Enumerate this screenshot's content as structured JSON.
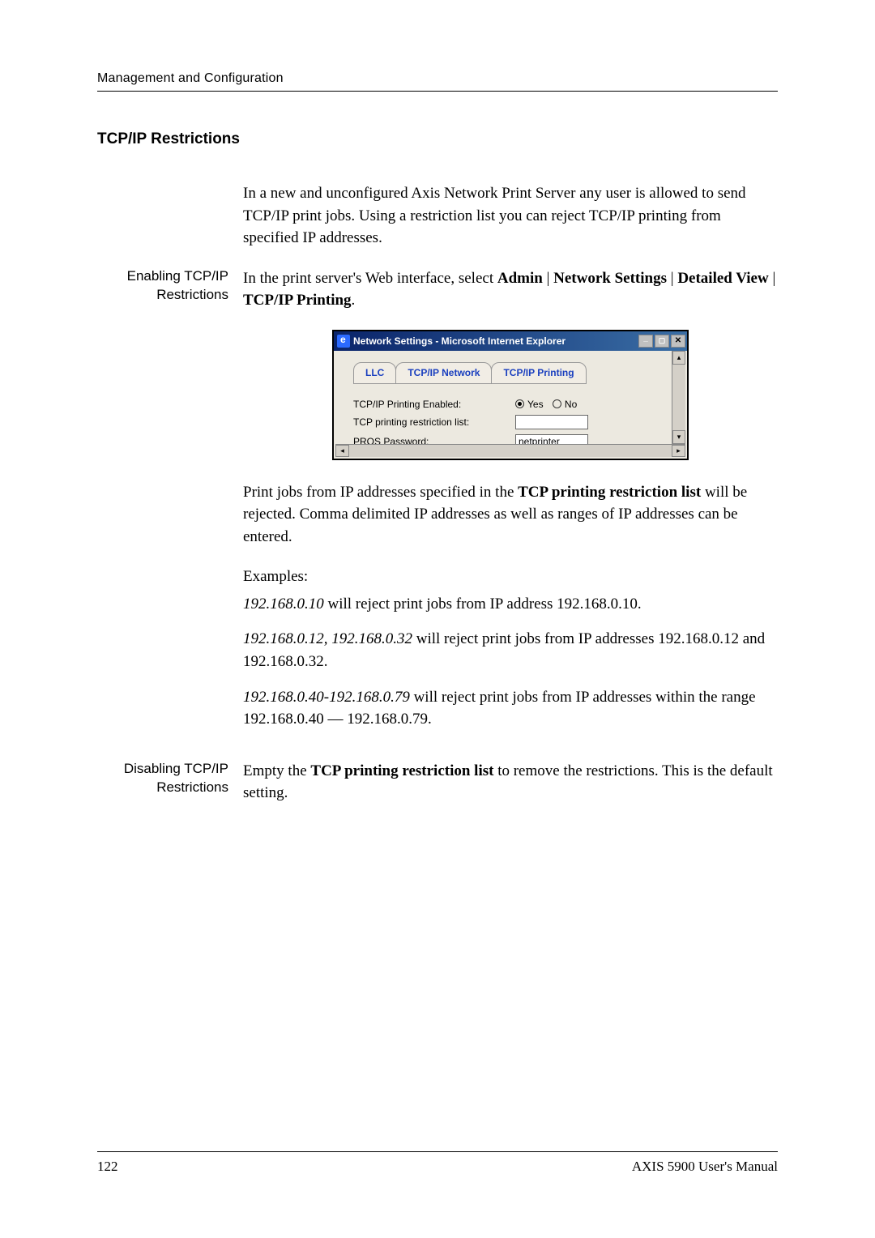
{
  "header": "Management and Configuration",
  "section_title": "TCP/IP Restrictions",
  "intro": "In a new and unconfigured Axis Network Print Server any user is allowed to send TCP/IP print jobs. Using a restriction list you can reject TCP/IP printing from specified IP addresses.",
  "enable": {
    "side1": "Enabling TCP/IP",
    "side2": "Restrictions",
    "pre": "In the print server's Web interface, select ",
    "b1": "Admin",
    "sep1": " | ",
    "b2": "Network Settings",
    "sep2": " | ",
    "b3": "Detailed View",
    "sep3": " | ",
    "b4": "TCP/IP Printing",
    "end": "."
  },
  "shot": {
    "title": "Network Settings - Microsoft Internet Explorer",
    "tabs": {
      "llc": "LLC",
      "net": "TCP/IP Network",
      "print": "TCP/IP Printing"
    },
    "row1_lbl": "TCP/IP Printing Enabled:",
    "row1_yes": "Yes",
    "row1_no": "No",
    "row2_lbl": "TCP printing restriction list:",
    "row3_lbl": "PROS Password:",
    "row3_val": "netprinter"
  },
  "below1_a": "Print jobs from IP addresses specified in the ",
  "below1_b": "TCP printing restriction list",
  "below1_c": " will be rejected. Comma delimited IP addresses as well as ranges of IP addresses can be entered.",
  "examples_h": "Examples:",
  "ex1_i": "192.168.0.10",
  "ex1_r": " will reject print jobs from IP address 192.168.0.10.",
  "ex2_i": "192.168.0.12, 192.168.0.32",
  "ex2_r": " will reject print jobs from IP addresses 192.168.0.12 and 192.168.0.32.",
  "ex3_i": "192.168.0.40-192.168.0.79",
  "ex3_r": " will reject print jobs from IP addresses within the range 192.168.0.40 — 192.168.0.79.",
  "disable": {
    "side1": "Disabling TCP/IP",
    "side2": "Restrictions",
    "a": "Empty the ",
    "b": "TCP printing restriction list",
    "c": " to remove the restrictions. This is the default setting."
  },
  "footer": {
    "page": "122",
    "manual": "AXIS 5900 User's Manual"
  }
}
